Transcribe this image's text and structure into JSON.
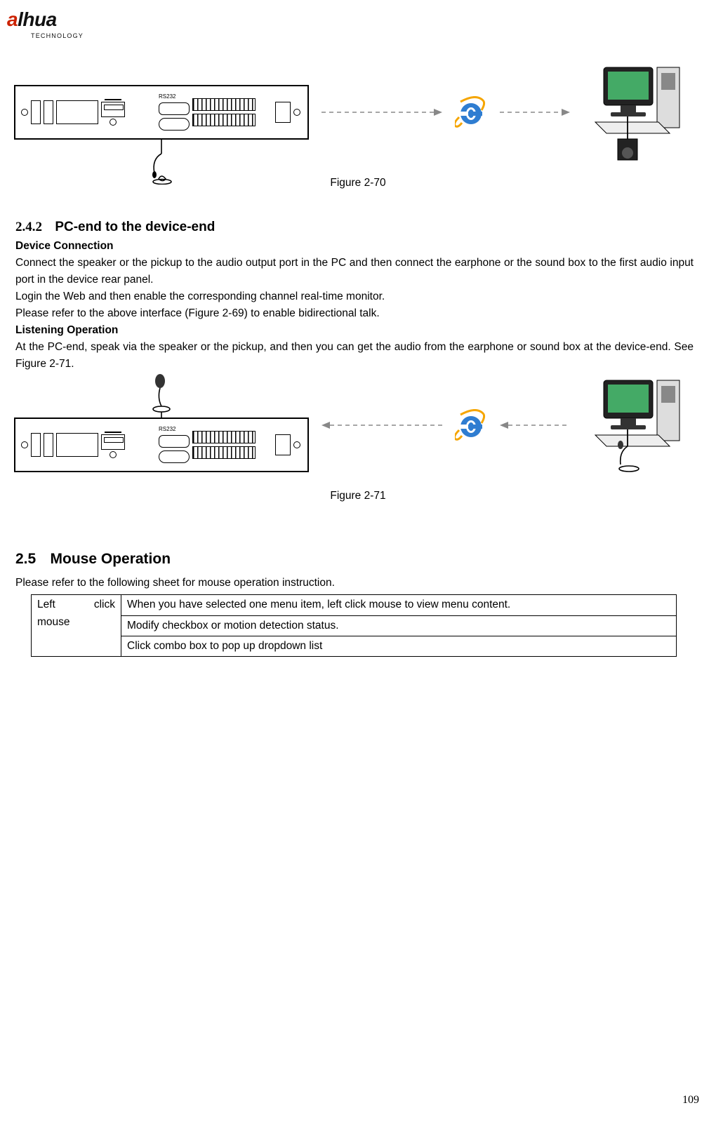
{
  "logo": {
    "text_a": "a",
    "text_rest": "lhua",
    "sub": "TECHNOLOGY"
  },
  "figures": {
    "f70": "Figure 2-70",
    "f71": "Figure 2-71"
  },
  "sec242": {
    "num": "2.4.2",
    "title": "PC-end to the device-end",
    "sub1": "Device Connection",
    "p1": "Connect the speaker or the pickup to the audio output port in the PC and then connect the earphone or the sound box to the first audio input port in the device rear panel.",
    "p2": "Login the Web and then enable the corresponding channel real-time monitor.",
    "p3": "Please refer to the above interface (Figure 2-69) to enable bidirectional talk.",
    "sub2": "Listening Operation",
    "p4": "At the PC-end, speak via the speaker or the pickup, and then you can get the audio from the earphone or sound box at the device-end. See Figure 2-71."
  },
  "sec25": {
    "num": "2.5",
    "title": "Mouse Operation",
    "intro": "Please refer to the following sheet for mouse operation instruction.",
    "table": {
      "left_label_w1": "Left",
      "left_label_w2": "click",
      "left_label_line2": "mouse",
      "rows": [
        "When you have selected one menu item, left click mouse to view menu content.",
        "Modify checkbox or motion detection status.",
        "Click combo box to pop up dropdown list"
      ]
    }
  },
  "page_number": "109"
}
